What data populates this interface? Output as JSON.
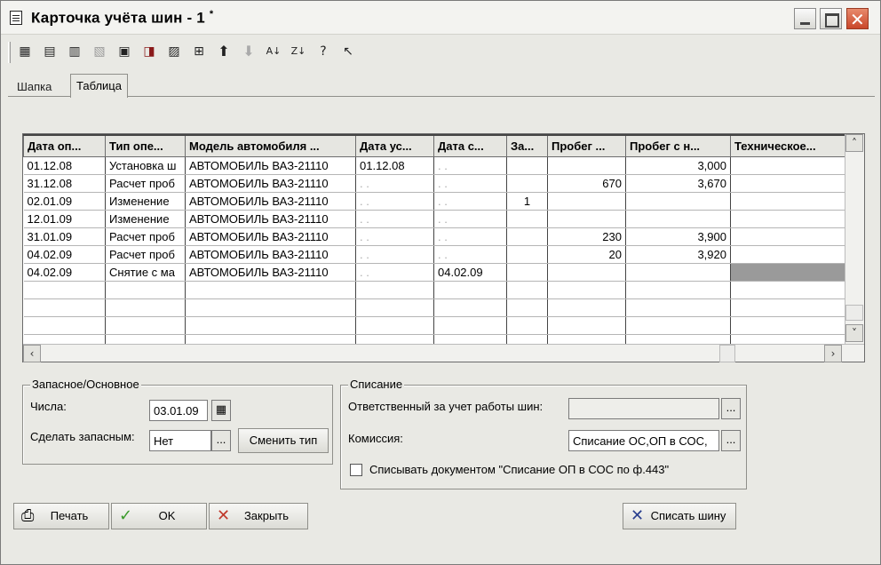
{
  "window": {
    "title": "Карточка учёта шин - 1",
    "modified_mark": "*"
  },
  "toolbar": {
    "icons": [
      "grid-add-icon",
      "grid-copy-icon",
      "grid-edit-icon",
      "grid-delete-icon",
      "document-icon",
      "document-delete-icon",
      "filter-icon",
      "move-icon",
      "arrow-up-icon",
      "arrow-down-icon",
      "sort-az-icon",
      "sort-za-icon",
      "help-icon",
      "select-pointer-icon"
    ]
  },
  "tabs": [
    {
      "label": "Шапка",
      "active": false
    },
    {
      "label": "Таблица",
      "active": true
    }
  ],
  "table": {
    "columns": [
      "Дата оп...",
      "Тип опе...",
      "Модель автомобиля ...",
      "Дата ус...",
      "Дата с...",
      "За...",
      "Пробег ...",
      "Пробег с н...",
      "Техническое..."
    ],
    "rows": [
      [
        "01.12.08",
        "Установка ш",
        "АВТОМОБИЛЬ ВАЗ-21110",
        "01.12.08",
        ". .",
        "",
        "",
        "3,000",
        ""
      ],
      [
        "31.12.08",
        "Расчет проб",
        "АВТОМОБИЛЬ ВАЗ-21110",
        ". .",
        ". .",
        "",
        "670",
        "3,670",
        ""
      ],
      [
        "02.01.09",
        "Изменение",
        "АВТОМОБИЛЬ ВАЗ-21110",
        ". .",
        ". .",
        "1",
        "",
        "",
        ""
      ],
      [
        "12.01.09",
        "Изменение",
        "АВТОМОБИЛЬ ВАЗ-21110",
        ". .",
        ". .",
        "",
        "",
        "",
        ""
      ],
      [
        "31.01.09",
        "Расчет проб",
        "АВТОМОБИЛЬ ВАЗ-21110",
        ". .",
        ". .",
        "",
        "230",
        "3,900",
        ""
      ],
      [
        "04.02.09",
        "Расчет проб",
        "АВТОМОБИЛЬ ВАЗ-21110",
        ". .",
        ". .",
        "",
        "20",
        "3,920",
        ""
      ],
      [
        "04.02.09",
        "Снятие с ма",
        "АВТОМОБИЛЬ ВАЗ-21110",
        ". .",
        "04.02.09",
        "",
        "",
        "",
        ""
      ]
    ],
    "empty_rows": 4
  },
  "spare_group": {
    "title": "Запасное/Основное",
    "date_label": "Числа:",
    "date_value": "03.01.09",
    "make_spare_label": "Сделать запасным:",
    "make_spare_value": "Нет",
    "ellipsis": "...",
    "change_type_button": "Сменить тип"
  },
  "writeoff_group": {
    "title": "Списание",
    "responsible_label": "Ответственный за учет работы шин:",
    "responsible_value": "",
    "commission_label": "Комиссия:",
    "commission_value": "Списание ОС,ОП в СОС,",
    "ellipsis": "...",
    "checkbox_label": "Списывать документом \"Списание ОП в СОС по ф.443\"",
    "checkbox_checked": false
  },
  "buttons": {
    "print": "Печать",
    "ok": "OK",
    "close": "Закрыть",
    "write_off": "Списать шину"
  },
  "colors": {
    "ok_check": "#3a9a2a",
    "close_x": "#c0392b",
    "writeoff_x": "#2a3f8f"
  }
}
